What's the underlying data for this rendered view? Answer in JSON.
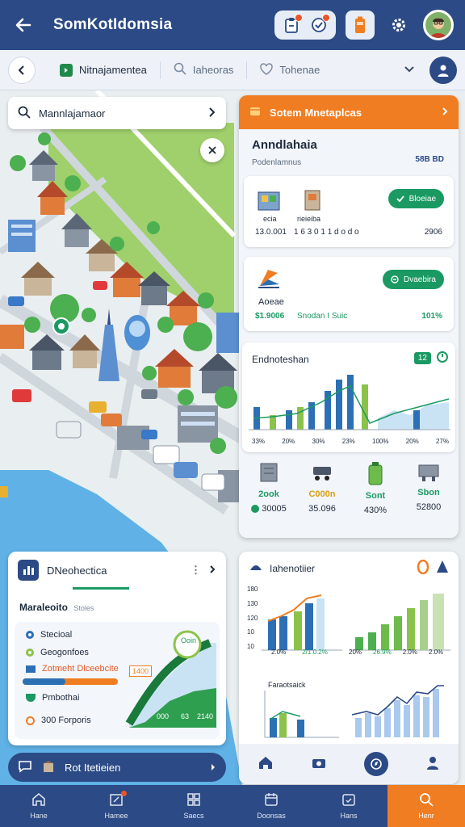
{
  "header": {
    "title": "SomKotIdomsia",
    "icons": [
      "back-arrow-icon",
      "clipboard-icon",
      "check-badge-icon",
      "battery-icon",
      "gear-icon",
      "avatar"
    ]
  },
  "tabs": {
    "items": [
      {
        "label": "Nitnajamentea",
        "icon": "app-square-icon"
      },
      {
        "label": "Iaheoras",
        "icon": "search-icon"
      },
      {
        "label": "Tohenae",
        "icon": "heart-icon"
      }
    ]
  },
  "map": {
    "search_value": "Mannlajamaor",
    "close_icon": "close-icon"
  },
  "right_panel": {
    "header": "Sotem Mnetaplcas",
    "title": "Anndlahaia",
    "subtitle": "Podenlamnus",
    "code": "58B BD",
    "card1": {
      "button": "Bloeiae",
      "item1_label": "ecia",
      "item2_label": "rieieiba",
      "item1_value": "13.0.001",
      "item2_value": "1 6 3 0 1 1 d o d o",
      "right_value": "2906"
    },
    "card2": {
      "button": "Dvaebira",
      "label": "Aoeae",
      "value1": "$1.9006",
      "value2": "Snodan I Suic",
      "value3": "101%"
    },
    "chart1": {
      "title": "Endnoteshan",
      "badge": "12",
      "ticks": [
        "33%",
        "20%",
        "30%",
        "23%",
        "100%",
        "20%",
        "27%"
      ]
    },
    "stats": [
      {
        "label": "2ook",
        "value": "30005",
        "color": "#1a9a62"
      },
      {
        "label": "C000n",
        "value": "35.096",
        "color": "#d9a012"
      },
      {
        "label": "Sont",
        "value": "430%",
        "color": "#1a9a62"
      },
      {
        "label": "Sbon",
        "value": "52800",
        "color": "#1a9a62"
      }
    ]
  },
  "left_panel": {
    "title": "DNeohectica",
    "subtitle_main": "Maraleoito",
    "subtitle_small": "Stoles",
    "legend": [
      {
        "label": "Stecioal",
        "color": "#2c6fb5"
      },
      {
        "label": "Geogonfoes",
        "color": "#8bc34a"
      },
      {
        "label": "Zotmeht Dlceebcite",
        "color": "#2c6fb5"
      },
      {
        "label": "Pmbothai",
        "color": "#1a9a62"
      },
      {
        "label": "300 Forporis",
        "color": "#f07d22"
      }
    ],
    "chart_labels": {
      "bubble": "Ooin",
      "tag1": "1400",
      "tag2": "000",
      "tag3": "2140",
      "tag4": "63"
    }
  },
  "bottom_pill": {
    "label": "Rot Itetieien"
  },
  "right_bottom_panel": {
    "title": "Iahenotiier",
    "y_ticks": [
      "180",
      "130",
      "120",
      "10",
      "10"
    ],
    "x_ticks_left": [
      "2.0%",
      "2/1.0.2%"
    ],
    "x_ticks_right": [
      "20%",
      "26.9%",
      "2.0%",
      "2.0%"
    ],
    "sub_title": "Faraotsaick"
  },
  "bottom_nav": {
    "items": [
      {
        "label": "Hane",
        "icon": "home-icon"
      },
      {
        "label": "Hamee",
        "icon": "map-edit-icon"
      },
      {
        "label": "Saecs",
        "icon": "grid-icon"
      },
      {
        "label": "Doonsas",
        "icon": "calendar-icon"
      },
      {
        "label": "Hans",
        "icon": "calendar-check-icon"
      },
      {
        "label": "Henr",
        "icon": "search-icon"
      }
    ]
  }
}
